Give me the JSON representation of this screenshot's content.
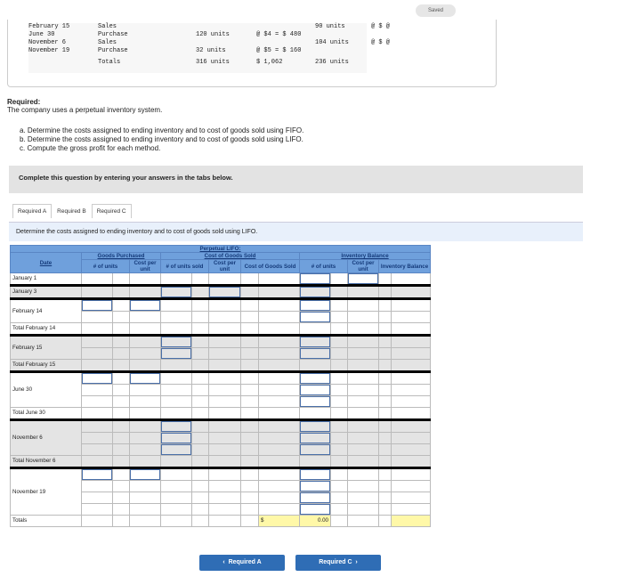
{
  "status": "Saved",
  "problem_rows": [
    {
      "date": "February 15",
      "type": "Sales",
      "units": "",
      "calc": "",
      "sold": "90 units",
      "sold_calc": "@ $ @"
    },
    {
      "date": "June 30",
      "type": "Purchase",
      "units": "120 units",
      "calc": "@ $4 = $ 480",
      "sold": "",
      "sold_calc": ""
    },
    {
      "date": "November 6",
      "type": "Sales",
      "units": "",
      "calc": "",
      "sold": "104 units",
      "sold_calc": "@ $ @"
    },
    {
      "date": "November 19",
      "type": "Purchase",
      "units": "32 units",
      "calc": "@ $5 = $ 160",
      "sold": "",
      "sold_calc": ""
    },
    {
      "date": "",
      "type": "Totals",
      "units": "316 units",
      "calc": "$ 1,062",
      "sold": "236 units",
      "sold_calc": ""
    }
  ],
  "required_title": "Required:",
  "required_text": "The company uses a perpetual inventory system.",
  "tasks": [
    "a. Determine the costs assigned to ending inventory and to cost of goods sold using FIFO.",
    "b. Determine the costs assigned to ending inventory and to cost of goods sold using LIFO.",
    "c. Compute the gross profit for each method."
  ],
  "complete_text": "Complete this question by entering your answers in the tabs below.",
  "tabs": [
    "Required A",
    "Required B",
    "Required C"
  ],
  "instruction": "Determine the costs assigned to ending inventory and to cost of goods sold using LIFO.",
  "table": {
    "title": "Perpetual LIFO:",
    "groups": [
      "Goods Purchased",
      "Cost of Goods Sold",
      "Inventory Balance"
    ],
    "headers": {
      "date": "Date",
      "p_units": "# of units",
      "p_cost": "Cost per unit",
      "s_units": "# of units sold",
      "s_cost": "Cost per unit",
      "s_total": "Cost of Goods Sold",
      "i_units": "# of units",
      "i_cost": "Cost per unit",
      "i_total": "Inventory Balance"
    },
    "rows": [
      {
        "label": "January 1",
        "sub": 1,
        "gray": false,
        "sep": true
      },
      {
        "label": "January 3",
        "sub": 1,
        "gray": true,
        "sep": true
      },
      {
        "label": "February 14",
        "sub": 2,
        "gray": false,
        "sep": false
      },
      {
        "label": "Total February 14",
        "sub": 1,
        "gray": false,
        "sep": true
      },
      {
        "label": "February 15",
        "sub": 2,
        "gray": true,
        "sep": false
      },
      {
        "label": "Total February 15",
        "sub": 1,
        "gray": true,
        "sep": true
      },
      {
        "label": "June 30",
        "sub": 3,
        "gray": false,
        "sep": false
      },
      {
        "label": "Total June 30",
        "sub": 1,
        "gray": false,
        "sep": true
      },
      {
        "label": "November 6",
        "sub": 3,
        "gray": true,
        "sep": false
      },
      {
        "label": "Total November 6",
        "sub": 1,
        "gray": true,
        "sep": true
      },
      {
        "label": "November 19",
        "sub": 4,
        "gray": false,
        "sep": false
      },
      {
        "label": "Totals",
        "sub": 1,
        "gray": false,
        "sep": false
      }
    ],
    "totals_currency": "$",
    "totals_cogs": "0.00"
  },
  "nav": {
    "prev": "Required A",
    "next": "Required C"
  }
}
